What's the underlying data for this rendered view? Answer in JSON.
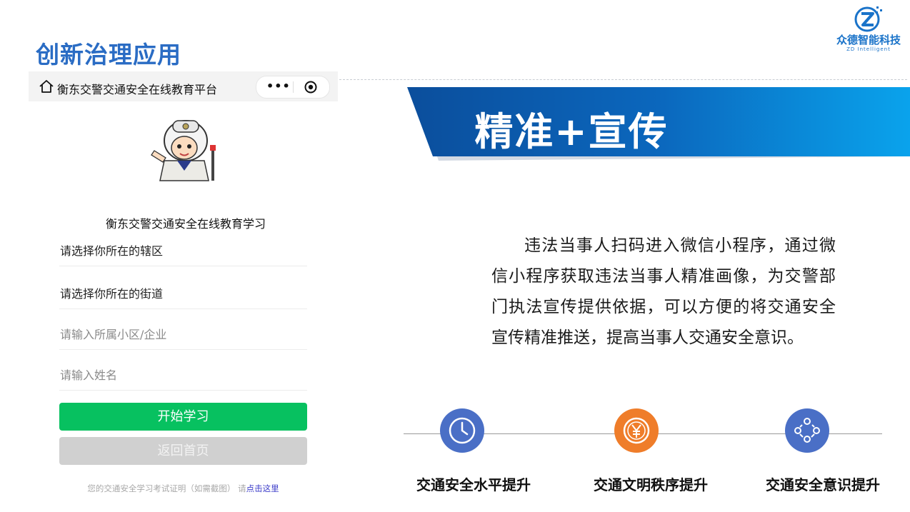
{
  "slide": {
    "title": "创新治理应用",
    "logo": {
      "name": "众德智能科技",
      "subtitle": "ZD Intelligent"
    },
    "banner": "精准+宣传",
    "description": "违法当事人扫码进入微信小程序，通过微信小程序获取违法当事人精准画像，为交警部门执法宣传提供依据，可以方便的将交通安全宣传精准推送，提高当事人交通安全意识。"
  },
  "phone": {
    "nav_title": "衡东交警交通安全在线教育平台",
    "app_heading": "衡东交警交通安全在线教育学习",
    "fields": [
      {
        "text": "请选择你所在的辖区"
      },
      {
        "text": "请选择你所在的街道"
      },
      {
        "placeholder": "请输入所属小区/企业"
      },
      {
        "placeholder": "请输入姓名"
      }
    ],
    "start_button": "开始学习",
    "home_button": "返回首页",
    "footnote": "您的交通安全学习考试证明（如需截图） 请",
    "footnote_link": "点击这里"
  },
  "metrics": [
    {
      "label": "交通安全水平提升",
      "icon": "clock-icon",
      "color": "#4a6fc6"
    },
    {
      "label": "交通文明秩序提升",
      "icon": "yuan-coin-icon",
      "color": "#ef7d2a"
    },
    {
      "label": "交通安全意识提升",
      "icon": "people-network-icon",
      "color": "#4a6fc6"
    }
  ],
  "colors": {
    "title": "#2a6cc4",
    "banner_start": "#0b5bb0",
    "banner_end": "#0aa0ea",
    "wechat_green": "#07c160"
  }
}
